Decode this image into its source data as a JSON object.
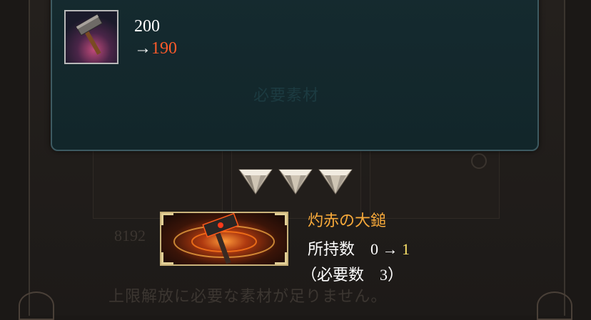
{
  "tooltip": {
    "icon": "hammer-icon",
    "current_value": "200",
    "arrow": "→",
    "new_value": "190",
    "faded_label": "必要素材"
  },
  "gems": {
    "icon": "diamond-gem-icon",
    "count": 3
  },
  "item": {
    "icon": "flaming-hammer-icon",
    "name": "灼赤の大鎚",
    "owned_label": "所持数",
    "owned_before": "0",
    "owned_arrow": "→",
    "owned_after": "1",
    "required_text": "（必要数　3）"
  },
  "background": {
    "number_text": "8192",
    "message": "上限解放に必要な素材が足りません。"
  },
  "colors": {
    "tooltip_bg": "#12262a",
    "tooltip_border": "#3d5a61",
    "new_value": "#ff5a2a",
    "item_name": "#f7a93a",
    "owned_after": "#ffe36a"
  }
}
